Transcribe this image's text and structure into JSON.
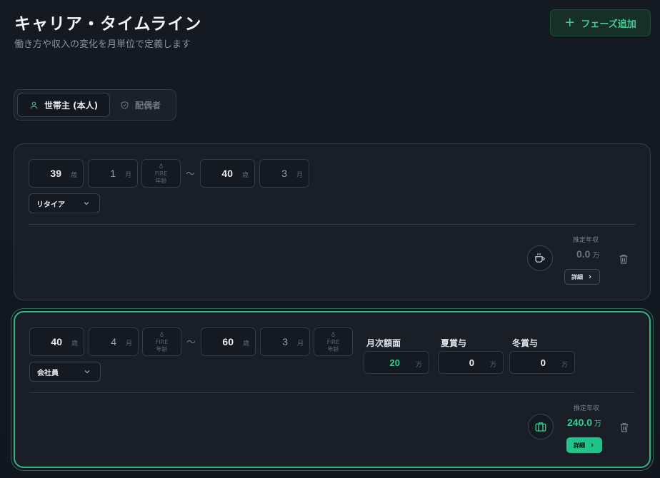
{
  "header": {
    "title": "キャリア・タイムライン",
    "subtitle": "働き方や収入の変化を月単位で定義します",
    "add_button": "フェーズ追加"
  },
  "person_tabs": [
    {
      "label": "世帯主 (本人)",
      "active": true,
      "icon": "user-icon"
    },
    {
      "label": "配偶者",
      "active": false,
      "icon": "shield-icon"
    }
  ],
  "units": {
    "age": "歳",
    "month": "月",
    "man": "万"
  },
  "fire_label": {
    "line1": "FIRE",
    "line2": "年齢"
  },
  "tilde": "～",
  "phases": [
    {
      "start_age": "39",
      "start_month": "1",
      "end_age": "40",
      "end_month": "3",
      "work_type": "リタイア",
      "income_label": "推定年収",
      "income_value": "0.0",
      "detail_label": "詳細",
      "icon": "coffee-icon",
      "selected": false
    },
    {
      "start_age": "40",
      "start_month": "4",
      "end_age": "60",
      "end_month": "3",
      "work_type": "会社員",
      "monthly_label": "月次額面",
      "monthly_value": "20",
      "summer_bonus_label": "夏賞与",
      "summer_bonus_value": "0",
      "winter_bonus_label": "冬賞与",
      "winter_bonus_value": "0",
      "income_label": "推定年収",
      "income_value": "240.0",
      "detail_label": "詳細",
      "icon": "briefcase-icon",
      "selected": true
    }
  ],
  "colors": {
    "accent": "#2fb582",
    "accent_text": "#3fcf92",
    "bg": "#141920"
  }
}
